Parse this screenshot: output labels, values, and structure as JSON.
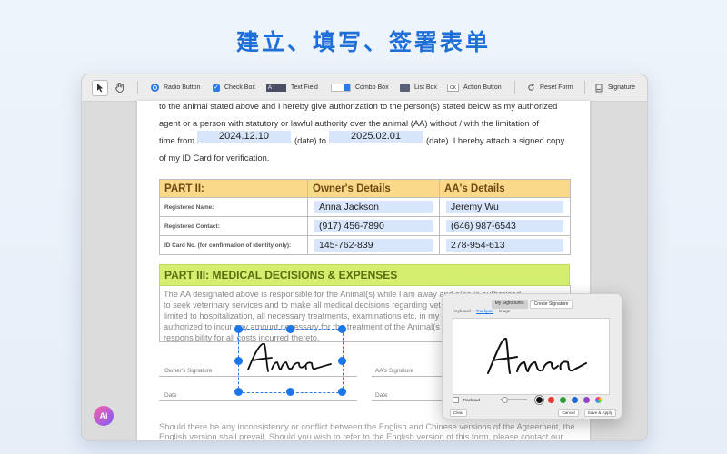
{
  "headline": "建立、填写、签署表单",
  "toolbar": {
    "radio_button": "Radio Button",
    "check_box": "Check Box",
    "text_field": "Text Field",
    "combo_box": "Combo Box",
    "list_box": "List Box",
    "action_button": "Action Button",
    "reset_form": "Reset Form",
    "signature": "Signature",
    "text_icon_letter": "A",
    "ok_icon_label": "OK"
  },
  "document": {
    "line1": "to the animal stated above and I hereby give authorization to the person(s) stated below as my authorized",
    "line2": "agent or a person with statutory or lawful authority over the animal (AA) without / with the limitation of",
    "line3_prefix": "time from",
    "date_from": "2024.12.10",
    "line3_mid": "(date) to",
    "date_to": "2025.02.01",
    "line3_suffix": "(date). I hereby attach a signed copy",
    "line4": "of my ID Card for verification.",
    "table": {
      "col1": "PART II:",
      "col2": "Owner's Details",
      "col3": "AA's Details",
      "rows": [
        {
          "label": "Registered Name:",
          "owner": "Anna Jackson",
          "aa": "Jeremy Wu"
        },
        {
          "label": "Registered Contact:",
          "owner": "(917) 456-7890",
          "aa": "(646) 987-6543"
        },
        {
          "label": "ID Card No. (for confirmation of identity only):",
          "owner": "145-762-839",
          "aa": "278-954-613"
        }
      ]
    },
    "part3_title": "PART III: MEDICAL DECISIONS & EXPENSES",
    "part3_lines": [
      "The AA designated above is responsible for the Animal(s) while I am away and s/he is authorized",
      "to seek veterinary services and to make all medical decisions regarding vet",
      "limited to hospitalization, all necessary treatments, examinations etc. in my",
      "authorized to incur any amount necessary for the treatment of the Animal(s",
      "responsibility for all costs incurred thereto."
    ],
    "owner_signature_label": "Owner's Signature",
    "aa_signature_label": "AA's Signature",
    "date_label_left": "Date",
    "date_label_right": "Date",
    "footer_line1": "Should there be any inconsistency or conflict between the English and Chinese versions of the Agreement, the",
    "footer_line2": "English version shall prevail. Should you wish to refer to the English version of this form, please contact our",
    "signature_text": "Anna"
  },
  "ai_button": "Ai",
  "signature_panel": {
    "tab_my": "My Signatures",
    "tab_create": "Create Signature",
    "sub_keyboard": "Keyboard",
    "sub_trackpad": "Trackpad",
    "sub_image": "Image",
    "trackpad_checkbox": "Trackpad",
    "clear": "Clear",
    "cancel": "Cancel",
    "save_apply": "Save & Apply",
    "signature_text": "Anna",
    "colors": [
      "#111111",
      "#e53935",
      "#2e9e3e",
      "#1a66d6",
      "#8e44c8"
    ]
  },
  "colors": {
    "accent": "#1f6fd9",
    "part2_header": "#fbd98b",
    "part3_header": "#d4ef70",
    "field_fill": "#d8e6fb",
    "handle": "#1a76ea"
  }
}
